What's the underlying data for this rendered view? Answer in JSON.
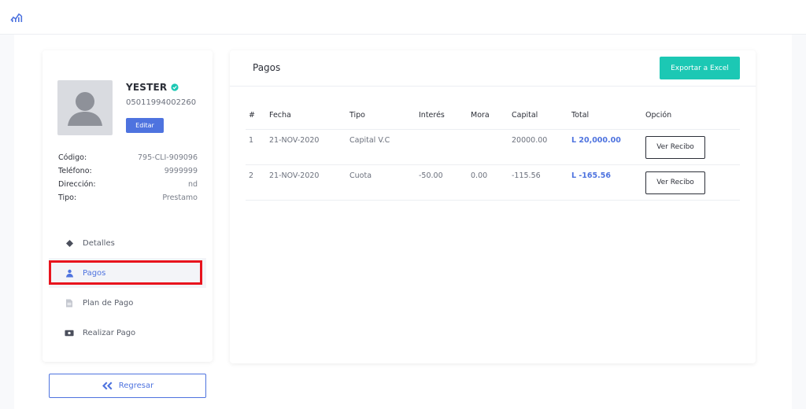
{
  "header": {
    "logo_icon": "chart-analytics-icon"
  },
  "profile": {
    "name": "YESTER",
    "verified_icon": "check-badge-icon",
    "id_number": "05011994002260",
    "edit_label": "Editar",
    "fields": [
      {
        "label": "Código:",
        "value": "795-CLI-909096"
      },
      {
        "label": "Teléfono:",
        "value": "9999999"
      },
      {
        "label": "Dirección:",
        "value": "nd"
      },
      {
        "label": "Tipo:",
        "value": "Prestamo"
      }
    ]
  },
  "nav": {
    "items": [
      {
        "label": "Detalles",
        "icon": "layers-icon"
      },
      {
        "label": "Pagos",
        "icon": "user-icon",
        "active": true
      },
      {
        "label": "Plan de Pago",
        "icon": "document-icon"
      },
      {
        "label": "Realizar Pago",
        "icon": "money-icon"
      }
    ]
  },
  "back_button": {
    "label": "Regresar",
    "icon": "double-chevron-left-icon"
  },
  "payments": {
    "title": "Pagos",
    "export_label": "Exportar a Excel",
    "columns": [
      "#",
      "Fecha",
      "Tipo",
      "Interés",
      "Mora",
      "Capital",
      "Total",
      "Opción"
    ],
    "rows": [
      {
        "num": "1",
        "fecha": "21-NOV-2020",
        "tipo": "Capital V.C",
        "interes": "",
        "mora": "",
        "capital": "20000.00",
        "total": "L 20,000.00",
        "option": "Ver Recibo"
      },
      {
        "num": "2",
        "fecha": "21-NOV-2020",
        "tipo": "Cuota",
        "interes": "-50.00",
        "mora": "0.00",
        "capital": "-115.56",
        "total": "L -165.56",
        "option": "Ver Recibo"
      }
    ]
  },
  "colors": {
    "accent": "#4e73df",
    "export": "#1cc8b4",
    "highlight": "#e8141e",
    "verified": "#1cc8b4"
  }
}
